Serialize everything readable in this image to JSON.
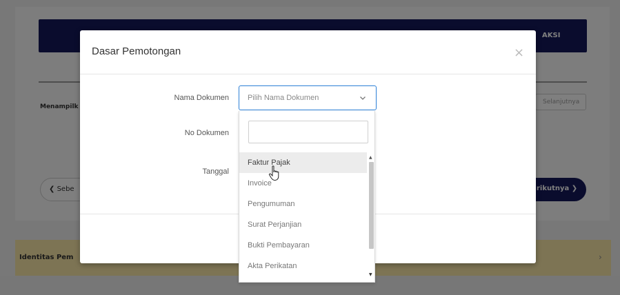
{
  "background": {
    "header_aksi": "AKSI",
    "menampilkan_text": "Menampilk",
    "selanjutnya_label": "Selanjutnya",
    "prev_button_label": "Sebe",
    "next_button_label": "rikutnya",
    "identitas_text": "Identitas Pem"
  },
  "modal": {
    "title": "Dasar Pemotongan",
    "close_label": "×",
    "fields": {
      "nama_dokumen_label": "Nama Dokumen",
      "no_dokumen_label": "No Dokumen",
      "tanggal_label": "Tanggal"
    },
    "nama_dokumen_select": {
      "value": "Pilih Nama Dokumen",
      "search_value": "",
      "options": [
        "Faktur Pajak",
        "Invoice",
        "Pengumuman",
        "Surat Perjanjian",
        "Bukti Pembayaran",
        "Akta Perikatan"
      ],
      "highlighted": "Faktur Pajak"
    }
  },
  "colors": {
    "brand_navy": "#14195a",
    "select_border": "#2b7fd6",
    "strip_yellow": "#fae8a8"
  },
  "icons": [
    "chevron-down-icon",
    "chevron-left-icon",
    "chevron-right-icon",
    "close-icon",
    "hand-cursor-icon"
  ]
}
